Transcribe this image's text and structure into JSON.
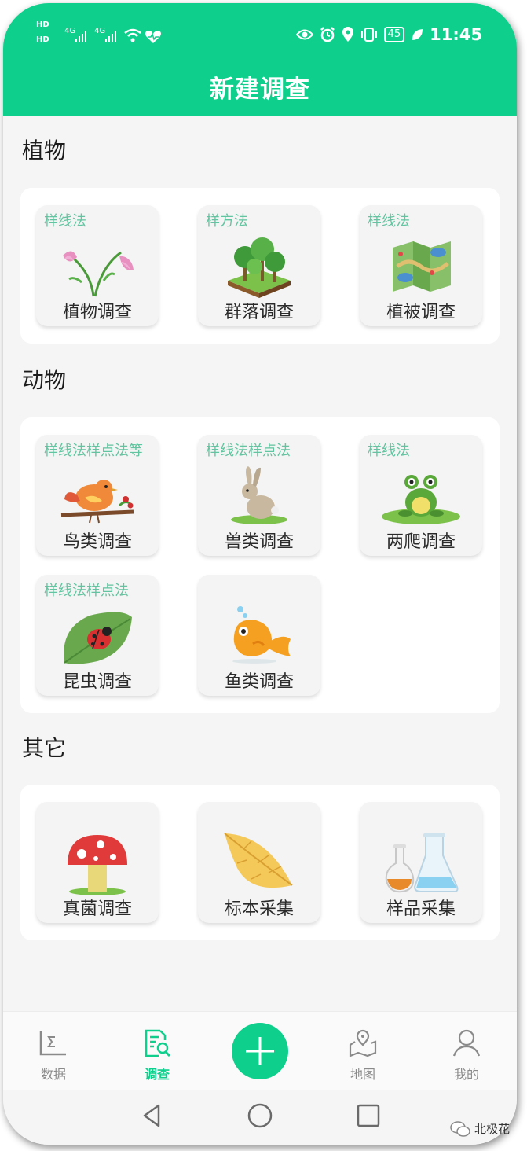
{
  "status_bar": {
    "hd1": "HD",
    "hd2": "HD",
    "signal1": "4G",
    "signal2": "4G",
    "battery": "45",
    "time": "11:45"
  },
  "header": {
    "title": "新建调查"
  },
  "sections": [
    {
      "title": "植物",
      "items": [
        {
          "method": "样线法",
          "label": "植物调查",
          "icon": "flower-icon"
        },
        {
          "method": "样方法",
          "label": "群落调查",
          "icon": "trees-icon"
        },
        {
          "method": "样线法",
          "label": "植被调查",
          "icon": "map-icon"
        }
      ]
    },
    {
      "title": "动物",
      "items": [
        {
          "method": "样线法样点法等",
          "label": "鸟类调查",
          "icon": "bird-icon"
        },
        {
          "method": "样线法样点法",
          "label": "兽类调查",
          "icon": "rabbit-icon"
        },
        {
          "method": "样线法",
          "label": "两爬调查",
          "icon": "frog-icon"
        },
        {
          "method": "样线法样点法",
          "label": "昆虫调查",
          "icon": "ladybug-icon"
        },
        {
          "method": "",
          "label": "鱼类调查",
          "icon": "fish-icon"
        }
      ]
    },
    {
      "title": "其它",
      "items": [
        {
          "method": "",
          "label": "真菌调查",
          "icon": "mushroom-icon"
        },
        {
          "method": "",
          "label": "标本采集",
          "icon": "leaf-icon"
        },
        {
          "method": "",
          "label": "样品采集",
          "icon": "flask-icon"
        }
      ]
    }
  ],
  "bottom_nav": {
    "items": [
      {
        "label": "数据",
        "icon": "chart-icon"
      },
      {
        "label": "调查",
        "icon": "survey-icon",
        "active": true
      },
      {
        "label": "地图",
        "icon": "map-pin-icon"
      },
      {
        "label": "我的",
        "icon": "user-icon"
      }
    ],
    "fab_icon": "plus-icon"
  },
  "system_nav": [
    "back-icon",
    "home-icon",
    "recents-icon"
  ],
  "watermark": "北极花",
  "colors": {
    "accent": "#0fcf8d",
    "method_text": "#62c4a1",
    "background": "#f5f5f5"
  }
}
